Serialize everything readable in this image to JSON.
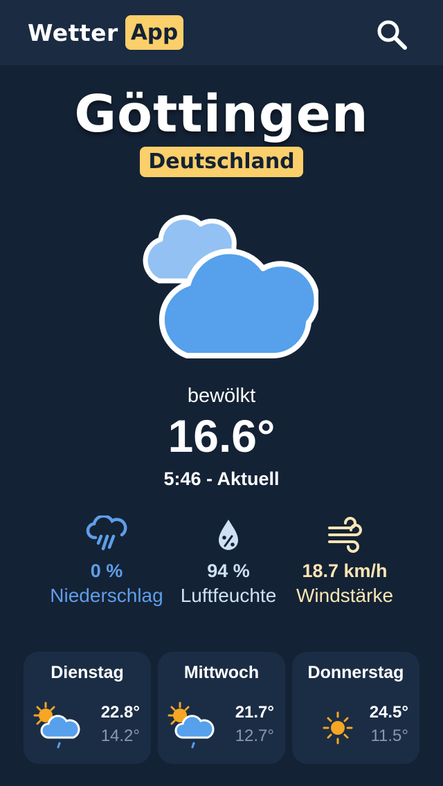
{
  "header": {
    "brand": "Wetter",
    "brand_badge": "App",
    "search_icon": "search-icon"
  },
  "location": {
    "city": "Göttingen",
    "country": "Deutschland"
  },
  "current": {
    "icon": "cloudy-icon",
    "condition": "bewölkt",
    "temperature": "16.6°",
    "time": "5:46 - Aktuell"
  },
  "stats": [
    {
      "icon": "rain-cloud-icon",
      "value": "0 %",
      "label": "Niederschlag",
      "color": "#5f9ee8"
    },
    {
      "icon": "humidity-drop-icon",
      "value": "94 %",
      "label": "Luftfeuchte",
      "color": "#cfe0f5"
    },
    {
      "icon": "wind-icon",
      "value": "18.7 km/h",
      "label": "Windstärke",
      "color": "#fbe6b4"
    }
  ],
  "forecast": [
    {
      "day": "Dienstag",
      "icon": "sun-cloud-rain-icon",
      "high": "22.8°",
      "low": "14.2°"
    },
    {
      "day": "Mittwoch",
      "icon": "sun-cloud-rain-icon",
      "high": "21.7°",
      "low": "12.7°"
    },
    {
      "day": "Donnerstag",
      "icon": "sun-icon",
      "high": "24.5°",
      "low": "11.5°"
    }
  ],
  "colors": {
    "background": "#142235",
    "header": "#1a2b42",
    "accent": "#fbcf6a",
    "card": "#1b2d45"
  }
}
